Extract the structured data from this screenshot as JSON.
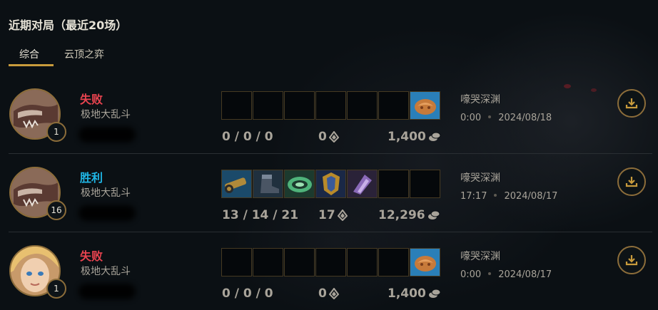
{
  "header": {
    "title": "近期对局（最近20场）"
  },
  "tabs": [
    {
      "label": "综合",
      "active": true
    },
    {
      "label": "云顶之弈",
      "active": false
    }
  ],
  "matches": [
    {
      "result": "失败",
      "result_type": "loss",
      "mode": "极地大乱斗",
      "level": "1",
      "kda": "0 / 0 / 0",
      "cs": "0",
      "gold": "1,400",
      "map": "嚎哭深渊",
      "duration": "0:00",
      "date": "2024/08/18",
      "items": [
        "",
        "",
        "",
        "",
        "",
        "",
        "poro-snax"
      ]
    },
    {
      "result": "胜利",
      "result_type": "win",
      "mode": "极地大乱斗",
      "level": "16",
      "kda": "13 / 14 / 21",
      "cs": "17",
      "gold": "12,296",
      "map": "嚎哭深渊",
      "duration": "17:17",
      "date": "2024/08/17",
      "items": [
        "cannon-item",
        "boots-item",
        "jade-item",
        "armor-item",
        "gauntlet-item",
        "",
        ""
      ]
    },
    {
      "result": "失败",
      "result_type": "loss",
      "mode": "极地大乱斗",
      "level": "1",
      "kda": "0 / 0 / 0",
      "cs": "0",
      "gold": "1,400",
      "map": "嚎哭深渊",
      "duration": "0:00",
      "date": "2024/08/17",
      "items": [
        "",
        "",
        "",
        "",
        "",
        "",
        "poro-snax"
      ]
    }
  ],
  "colors": {
    "accent": "#c89b3c",
    "loss": "#e8434f",
    "win": "#1fb6e6"
  }
}
